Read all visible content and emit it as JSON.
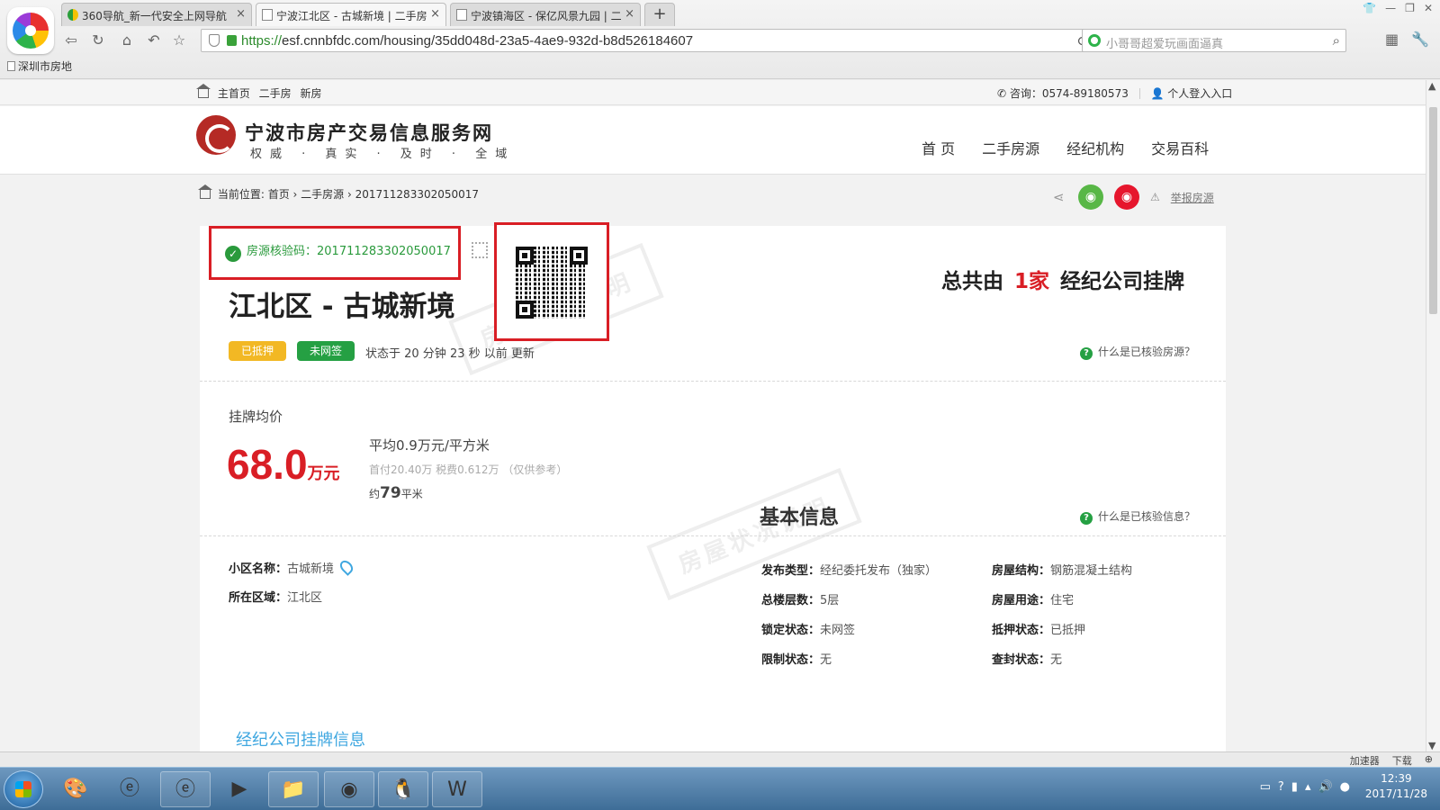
{
  "browser": {
    "tabs": [
      {
        "label": "360导航_新一代安全上网导航",
        "active": false,
        "icon": "nav-icon"
      },
      {
        "label": "宁波江北区 - 古城新境 | 二手房",
        "active": true,
        "icon": "page-icon"
      },
      {
        "label": "宁波镇海区 - 保亿风景九园 | 二",
        "active": false,
        "icon": "page-icon"
      }
    ],
    "new_tab": "+",
    "url_scheme": "https://",
    "url_rest": "esf.cnnbfdc.com/housing/35dd048d-23a5-4ae9-932d-b8d526184607",
    "search_placeholder": "小哥哥超爱玩画面逼真",
    "bookmark": "深圳市房地"
  },
  "topbar": {
    "links": [
      "主首页",
      "二手房",
      "新房"
    ],
    "consult": "咨询：0574-89180573",
    "login": "个人登入入口"
  },
  "header": {
    "site_name": "宁波市房产交易信息服务网",
    "slogan": "权威 · 真实 · 及时 · 全域",
    "nav": [
      "首 页",
      "二手房源",
      "经纪机构",
      "交易百科"
    ]
  },
  "breadcrumb": {
    "label": "当前位置:",
    "items": [
      "首页",
      "二手房源",
      "201711283302050017"
    ]
  },
  "social": {
    "report": "举报房源"
  },
  "listing": {
    "verify_label": "房源核验码：201711283302050017",
    "title": "江北区 - 古城新境",
    "agency_prefix": "总共由",
    "agency_count": "1家",
    "agency_suffix": "经纪公司挂牌",
    "badge_mortgage": "已抵押",
    "badge_contract": "未网签",
    "status_time": "状态于 20 分钟 23 秒 以前 更新",
    "help_verified_source": "什么是已核验房源？",
    "price_label": "挂牌均价",
    "price_value": "68.0",
    "price_unit": "万元",
    "avg_price": "平均0.9万元/平方米",
    "down_payment": "首付20.40万 税费0.612万 （仅供参考）",
    "area_prefix": "约",
    "area_value": "79",
    "area_unit": "平米",
    "basic_info_title": "基本信息",
    "help_verified_info": "什么是已核验信息？",
    "stamp_text": "房屋状况说明"
  },
  "info": {
    "community_label": "小区名称：",
    "community_value": "古城新境",
    "district_label": "所在区域：",
    "district_value": "江北区",
    "pub_type_label": "发布类型：",
    "pub_type_value": "经纪委托发布（独家）",
    "floors_label": "总楼层数：",
    "floors_value": "5层",
    "lock_label": "锁定状态：",
    "lock_value": "未网签",
    "restrict_label": "限制状态：",
    "restrict_value": "无",
    "structure_label": "房屋结构：",
    "structure_value": "钢筋混凝土结构",
    "usage_label": "房屋用途：",
    "usage_value": "住宅",
    "mortgage_label": "抵押状态：",
    "mortgage_value": "已抵押",
    "seal_label": "查封状态：",
    "seal_value": "无"
  },
  "section2": {
    "title": "经纪公司挂牌信息"
  },
  "status_bar": {
    "accelerator": "加速器",
    "download": "下载"
  },
  "taskbar": {
    "time": "12:39",
    "date": "2017/11/28"
  }
}
